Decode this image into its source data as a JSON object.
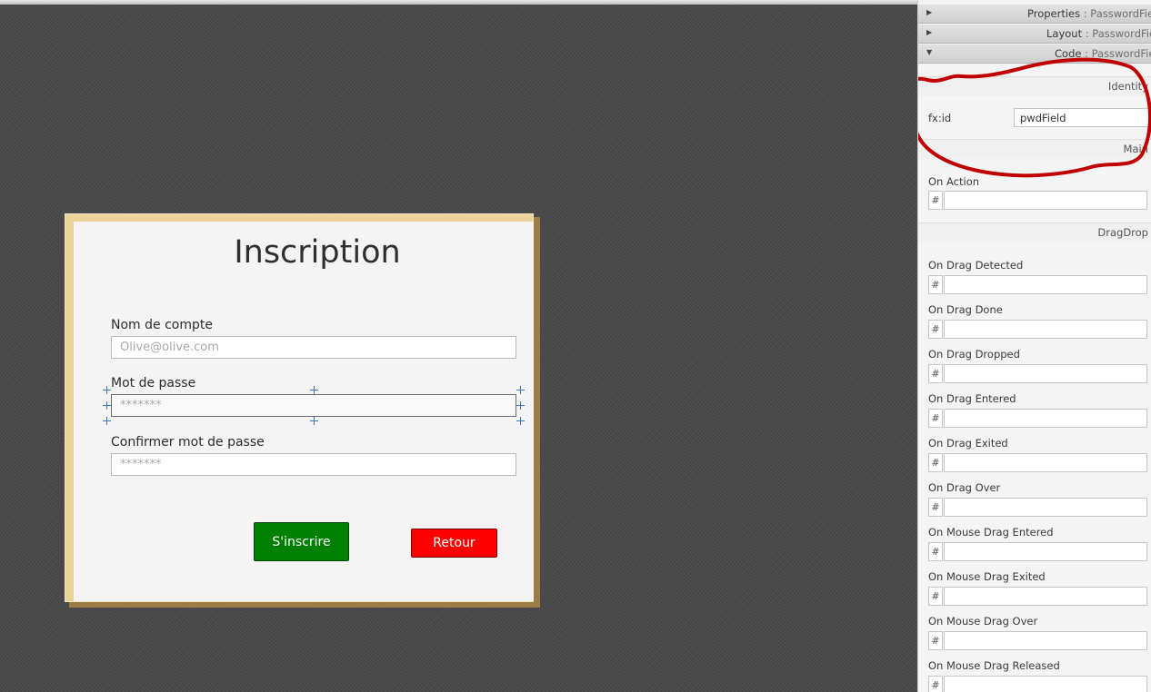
{
  "form": {
    "title": "Inscription",
    "fields": [
      {
        "label": "Nom de compte",
        "placeholder": "Olive@olive.com"
      },
      {
        "label": "Mot de passe",
        "placeholder": "*******"
      },
      {
        "label": "Confirmer mot de passe",
        "placeholder": "*******"
      }
    ],
    "buttons": {
      "submit": "S'inscrire",
      "back": "Retour"
    },
    "colors": {
      "submit": "#008000",
      "back": "#ff0000",
      "frame": "#ecd39a"
    }
  },
  "inspector": {
    "sections": [
      {
        "name": "Properties",
        "subject": ": PasswordField",
        "expanded": false
      },
      {
        "name": "Layout",
        "subject": ": PasswordField",
        "expanded": false
      },
      {
        "name": "Code",
        "subject": ": PasswordField",
        "expanded": true
      }
    ],
    "identity": {
      "header": "Identity",
      "label": "fx:id",
      "value": "pwdField"
    },
    "main": {
      "header": "Main",
      "label": "On Action",
      "hash": "#"
    },
    "dragdrop": {
      "header": "DragDrop",
      "hash": "#",
      "events": [
        "On Drag Detected",
        "On Drag Done",
        "On Drag Dropped",
        "On Drag Entered",
        "On Drag Exited",
        "On Drag Over",
        "On Mouse Drag Entered",
        "On Mouse Drag Exited",
        "On Mouse Drag Over",
        "On Mouse Drag Released"
      ]
    },
    "annotation_color": "#c00000"
  }
}
